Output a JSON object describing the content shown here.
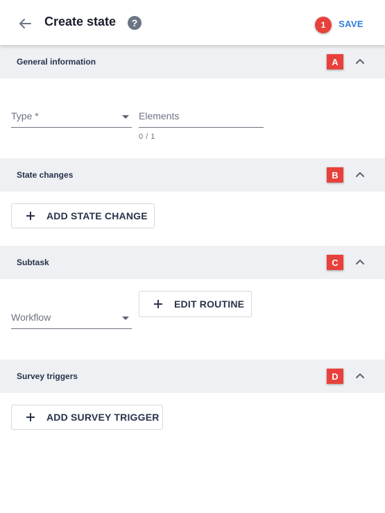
{
  "header": {
    "title": "Create state",
    "help_icon": "?",
    "marker": "1",
    "save_label": "SAVE",
    "back_icon": "arrow-left",
    "accent_color": "#2f7fd8"
  },
  "sections": {
    "general": {
      "title": "General information",
      "marker": "A"
    },
    "state_changes": {
      "title": "State changes",
      "marker": "B"
    },
    "subtask": {
      "title": "Subtask",
      "marker": "C"
    },
    "survey": {
      "title": "Survey triggers",
      "marker": "D"
    }
  },
  "general": {
    "type_label": "Type *",
    "elements_label": "Elements",
    "elements_counter": "0 / 1"
  },
  "state_changes": {
    "add_label": "ADD STATE CHANGE"
  },
  "subtask": {
    "workflow_label": "Workflow",
    "edit_routine_label": "EDIT ROUTINE"
  },
  "survey": {
    "add_label": "ADD SURVEY TRIGGER"
  },
  "colors": {
    "marker_red": "#e8413c",
    "section_bg": "#eef0f3"
  }
}
